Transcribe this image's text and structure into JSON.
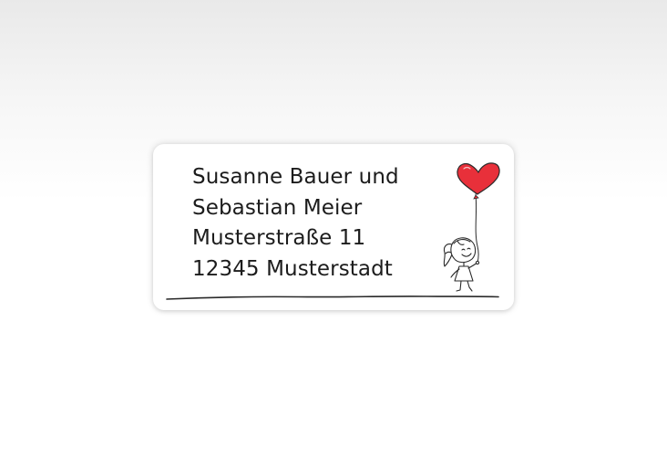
{
  "address_label": {
    "lines": [
      "Susanne Bauer und",
      "Sebastian Meier",
      "Musterstraße 11",
      "12345 Musterstadt"
    ]
  },
  "illustration": {
    "subject": "girl-with-heart-balloon-icon",
    "balloon_color": "#e8303a",
    "ink_color": "#2a2a2a"
  }
}
